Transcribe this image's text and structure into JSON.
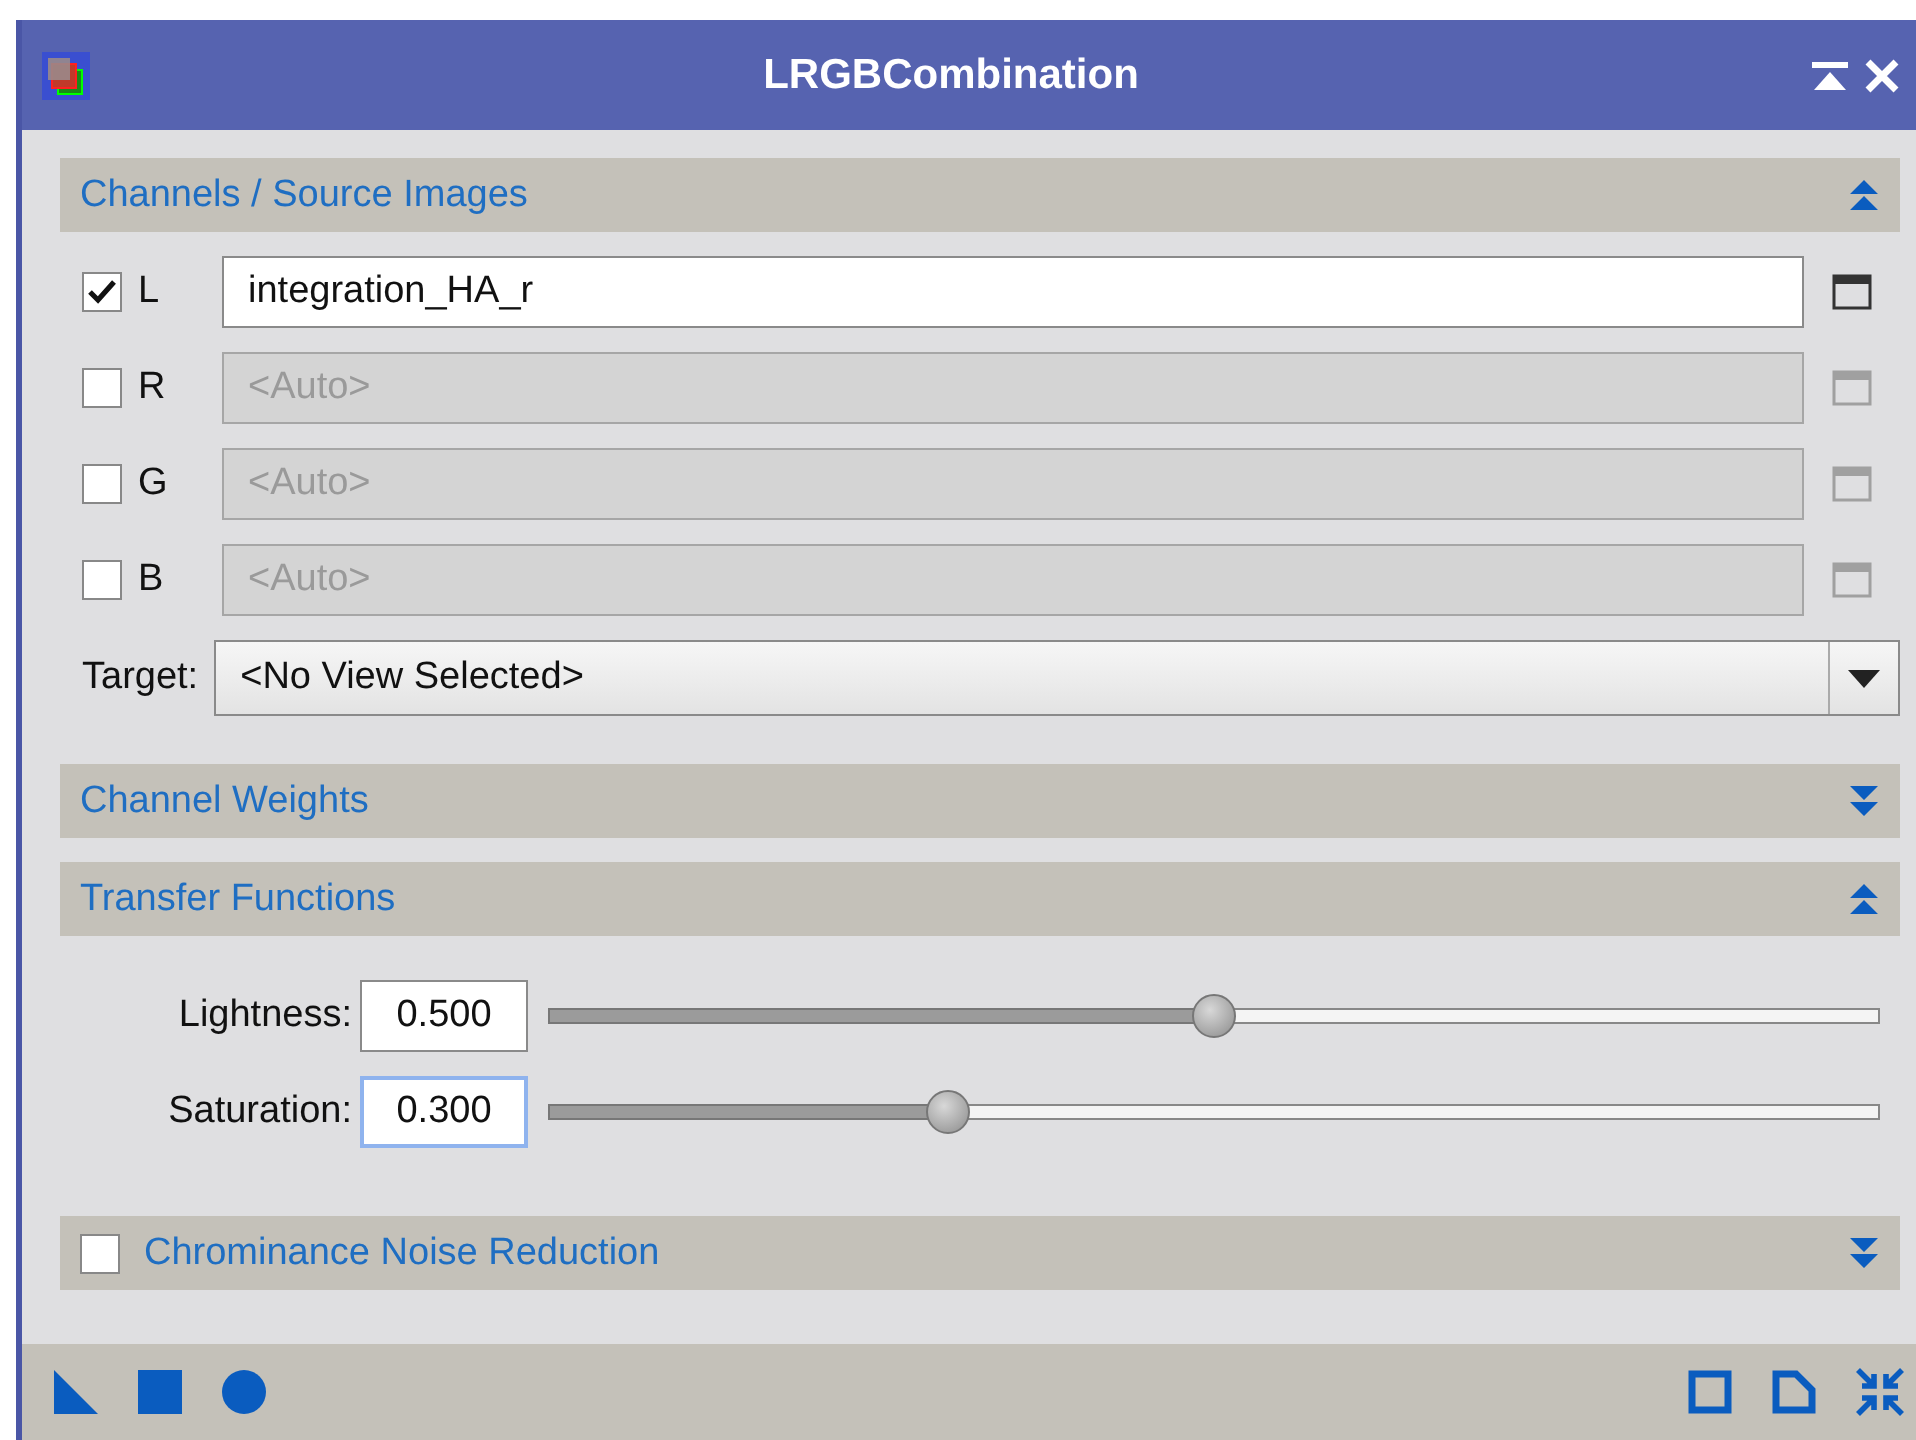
{
  "window": {
    "title": "LRGBCombination"
  },
  "sections": [
    {
      "kind": "channels",
      "title": "Channels / Source Images",
      "expanded": true,
      "channels": [
        {
          "label": "L",
          "checked": true,
          "value": "integration_HA_r"
        },
        {
          "label": "R",
          "checked": false,
          "placeholder": "<Auto>"
        },
        {
          "label": "G",
          "checked": false,
          "placeholder": "<Auto>"
        },
        {
          "label": "B",
          "checked": false,
          "placeholder": "<Auto>"
        }
      ],
      "target": {
        "label": "Target:",
        "value": "<No View Selected>"
      }
    },
    {
      "kind": "plain",
      "title": "Channel Weights",
      "expanded": false
    },
    {
      "kind": "transfer",
      "title": "Transfer Functions",
      "expanded": true,
      "params": [
        {
          "label": "Lightness:",
          "value": "0.500",
          "level": 0.5,
          "focused": false
        },
        {
          "label": "Saturation:",
          "value": "0.300",
          "level": 0.3,
          "focused": true
        }
      ]
    },
    {
      "kind": "checkable",
      "title": "Chrominance Noise Reduction",
      "expanded": false,
      "checked": false
    }
  ]
}
